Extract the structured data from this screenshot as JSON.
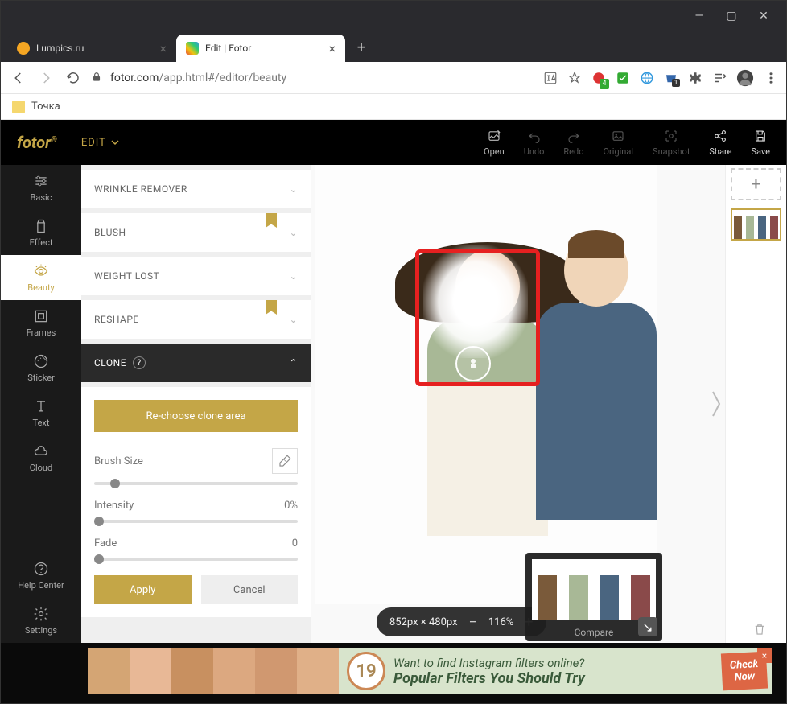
{
  "window": {
    "minimize": "—",
    "maximize": "▢",
    "close": "✕"
  },
  "tabs": [
    {
      "title": "Lumpics.ru",
      "active": false
    },
    {
      "title": "Edit | Fotor",
      "active": true
    }
  ],
  "new_tab": "+",
  "address": {
    "domain": "fotor.com",
    "path": "/app.html#/editor/beauty"
  },
  "bookmark": {
    "label": "Точка"
  },
  "app": {
    "logo": "fotor",
    "mode": "EDIT",
    "top_actions": [
      "Open",
      "Undo",
      "Redo",
      "Original",
      "Snapshot",
      "Share",
      "Save"
    ]
  },
  "leftnav": {
    "items": [
      "Basic",
      "Effect",
      "Beauty",
      "Frames",
      "Sticker",
      "Text",
      "Cloud"
    ],
    "footer": [
      "Help Center",
      "Settings"
    ],
    "active": "Beauty"
  },
  "panel": {
    "collapsed": [
      {
        "label": "WRINKLE REMOVER",
        "ribbon": false
      },
      {
        "label": "BLUSH",
        "ribbon": true
      },
      {
        "label": "WEIGHT LOST",
        "ribbon": false
      },
      {
        "label": "RESHAPE",
        "ribbon": true
      }
    ],
    "expanded": {
      "label": "CLONE"
    },
    "rechoose": "Re-choose clone area",
    "controls": {
      "brush": {
        "label": "Brush Size",
        "value": "",
        "pos": 8
      },
      "intensity": {
        "label": "Intensity",
        "value": "0%",
        "pos": 0
      },
      "fade": {
        "label": "Fade",
        "value": "0",
        "pos": 0
      }
    },
    "apply": "Apply",
    "cancel": "Cancel"
  },
  "canvas": {
    "dimensions": "852px × 480px",
    "zoom": "116%",
    "compare": "Compare"
  },
  "ad": {
    "badge": "19",
    "line1": "Want to find Instagram filters online?",
    "line2": "Popular Filters You Should Try",
    "cta1": "Check",
    "cta2": "Now"
  }
}
